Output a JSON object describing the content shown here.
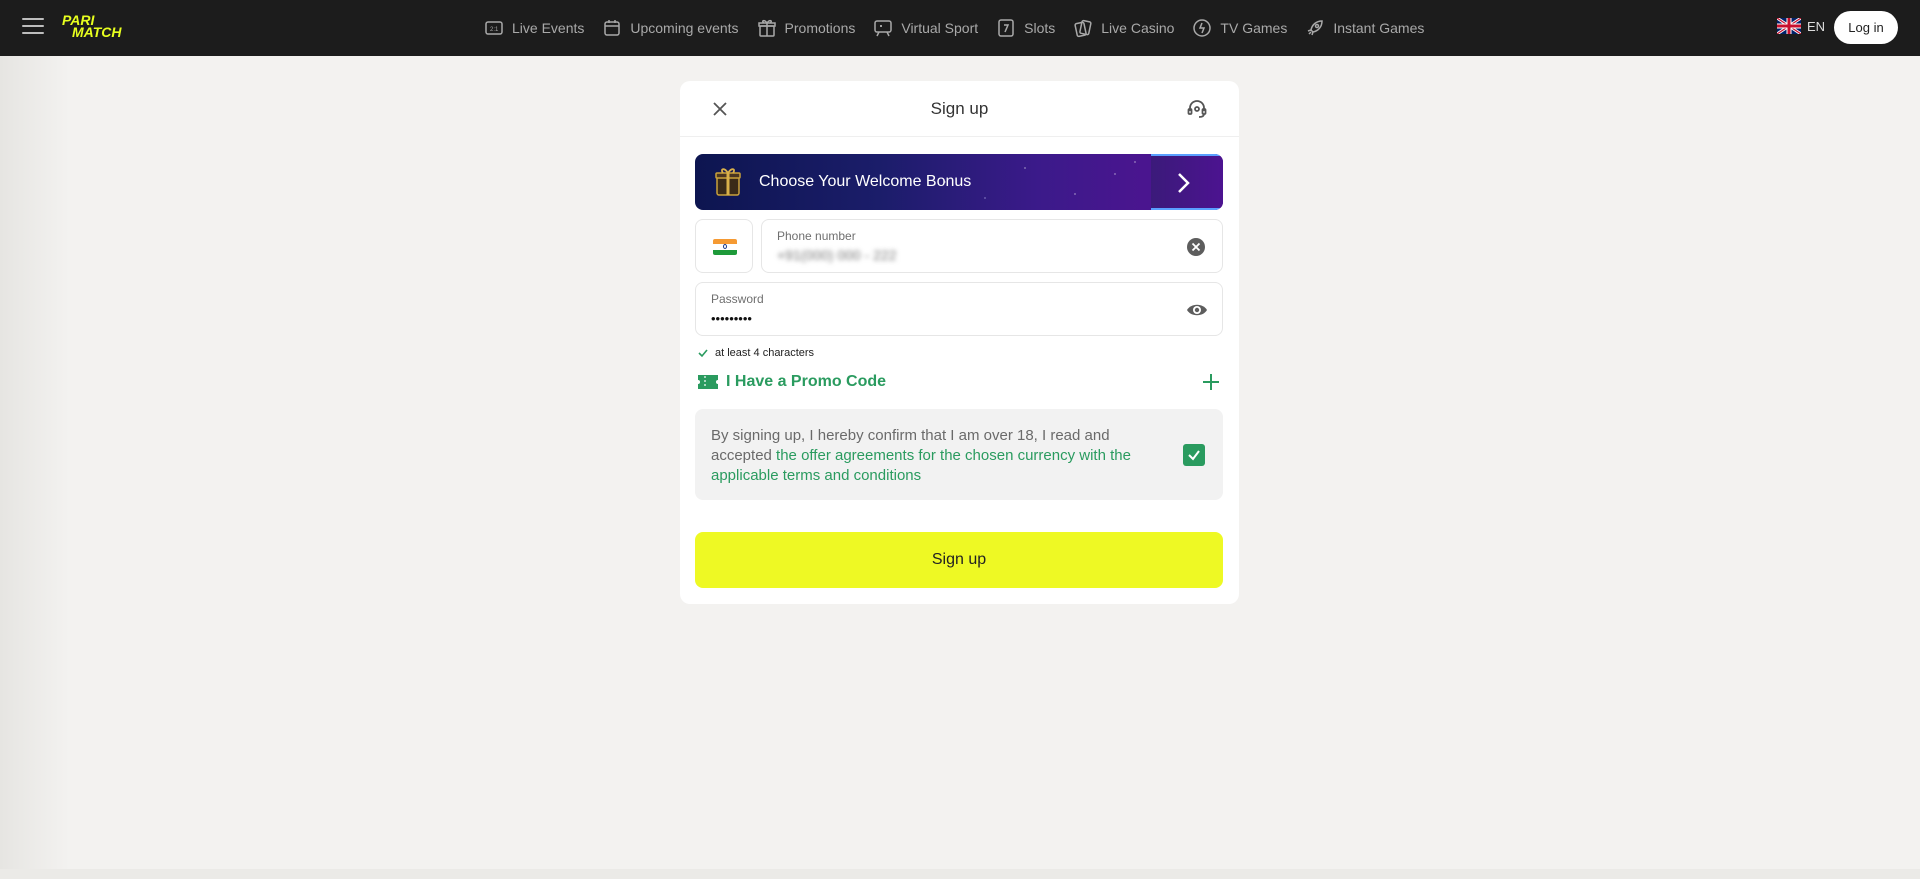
{
  "colors": {
    "topbar_bg": "#1c1c1c",
    "logo": "#e8ff1f",
    "accent_green": "#2a9b5f",
    "signup_yellow": "#eef924"
  },
  "header": {
    "logo_line1": "PARI",
    "logo_line2": "MATCH",
    "nav": [
      {
        "label": "Live Events",
        "icon": "live-events-icon"
      },
      {
        "label": "Upcoming events",
        "icon": "calendar-icon"
      },
      {
        "label": "Promotions",
        "icon": "gift-icon"
      },
      {
        "label": "Virtual Sport",
        "icon": "virtual-sport-icon"
      },
      {
        "label": "Slots",
        "icon": "slots-icon"
      },
      {
        "label": "Live Casino",
        "icon": "cards-icon"
      },
      {
        "label": "TV Games",
        "icon": "tv-games-icon"
      },
      {
        "label": "Instant Games",
        "icon": "rocket-icon"
      }
    ],
    "language": "EN",
    "login_label": "Log in"
  },
  "modal": {
    "title": "Sign up",
    "bonus_banner": "Choose Your Welcome Bonus",
    "phone": {
      "label": "Phone number",
      "value": "+91(000) 000 - 222"
    },
    "password": {
      "label": "Password",
      "value": "•••••••••"
    },
    "password_hint": "at least 4 characters",
    "promo_label": "I Have a Promo Code",
    "terms": {
      "text": "By signing up, I hereby confirm that I am over 18, I read and accepted ",
      "link": "the offer agreements for the chosen currency with the applicable terms and conditions",
      "checked": true
    },
    "submit_label": "Sign up"
  }
}
